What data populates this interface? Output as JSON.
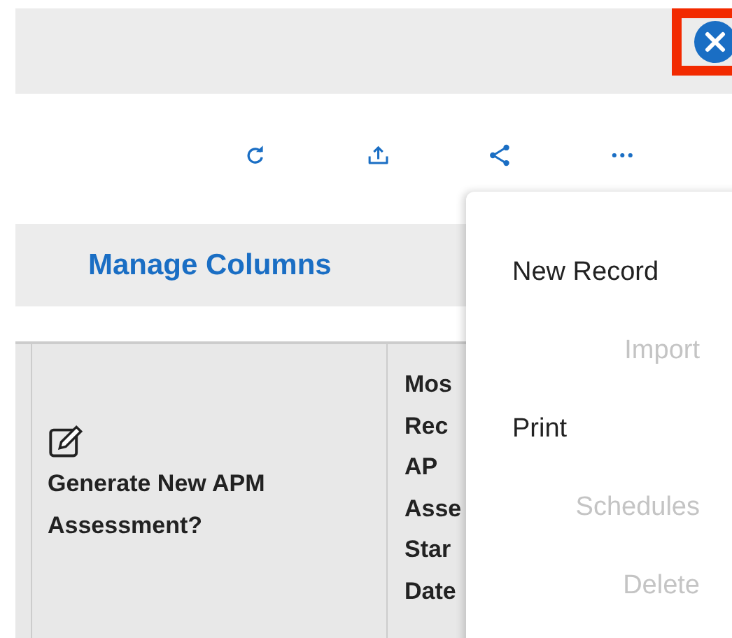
{
  "header_bar": {
    "close_highlighted": true
  },
  "toolbar": [
    {
      "kind": "refresh"
    },
    {
      "kind": "upload"
    },
    {
      "kind": "share"
    },
    {
      "kind": "more"
    }
  ],
  "manage_columns": {
    "label": "Manage Columns"
  },
  "table": {
    "columns": [
      {
        "kind": "edit",
        "lines": [
          "Generate New APM",
          "Assessment?"
        ]
      },
      {
        "kind": "text",
        "lines": [
          "Mos",
          "Rec",
          "AP",
          "Asse",
          "Star",
          "Date"
        ]
      }
    ]
  },
  "menu": {
    "items": [
      {
        "label": "New Record",
        "disabled": false
      },
      {
        "label": "Import",
        "disabled": true
      },
      {
        "label": "Print",
        "disabled": false
      },
      {
        "label": "Schedules",
        "disabled": true
      },
      {
        "label": "Delete",
        "disabled": true
      }
    ]
  }
}
